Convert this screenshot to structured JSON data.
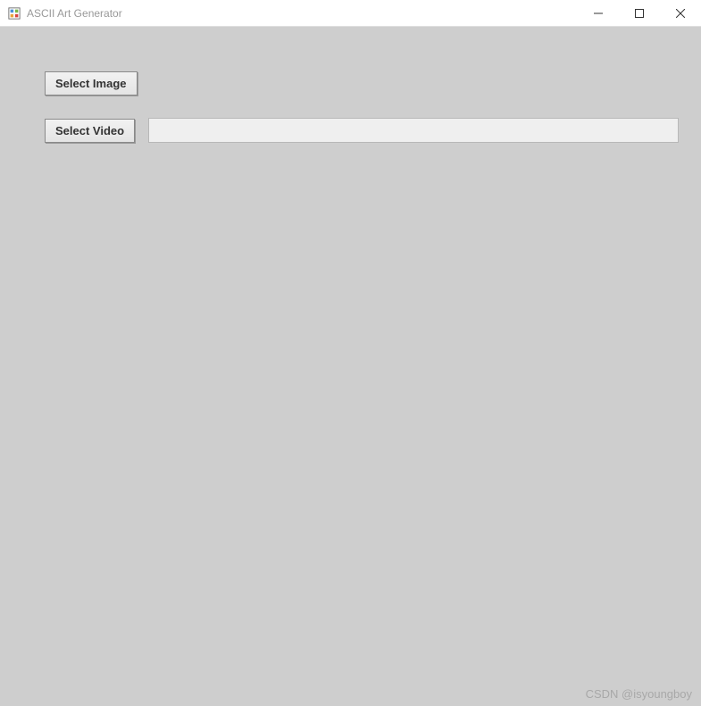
{
  "window": {
    "title": "ASCII Art Generator"
  },
  "buttons": {
    "select_image": "Select Image",
    "select_video": "Select Video"
  },
  "watermark": "CSDN @isyoungboy"
}
